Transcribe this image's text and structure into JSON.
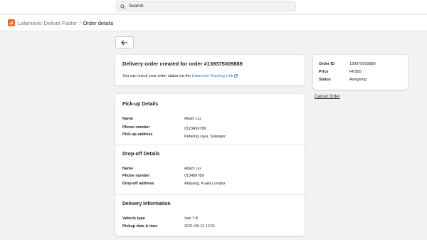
{
  "search": {
    "placeholder": "Search"
  },
  "breadcrumb": {
    "app": "Lalamove: Deliver Faster",
    "separator": "/",
    "current": "Order details"
  },
  "colors": {
    "brand": "#f16622",
    "link": "#2c6ecb"
  },
  "banner": {
    "title": "Delivery order created for order #139375009889",
    "text": "You can check your order status via the",
    "link_text": "Lalamove Tracking Link"
  },
  "summary": {
    "order_id_label": "Order ID",
    "order_id": "139375009889",
    "price_label": "Price",
    "price": "HK$55",
    "status_label": "Status",
    "status": "Assigning"
  },
  "cancel_label": "Cancel Order",
  "pickup": {
    "title": "Pick-up Details",
    "name_label": "Name",
    "name": "Adam Liu",
    "phone_label": "Phone number",
    "phone": "0123456789",
    "address_label": "Pick-up address",
    "address": "Petaling Jaya, Selangor"
  },
  "dropoff": {
    "title": "Drop-off Details",
    "name_label": "Name",
    "name": "Adam Liu",
    "phone_label": "Phone number",
    "phone": "013456789",
    "address_label": "Drop-off address",
    "address": "Ampang, Kuala Lumpur"
  },
  "delivery": {
    "title": "Delivery Information",
    "vehicle_label": "Vehicle type",
    "vehicle": "Van 7-ft",
    "datetime_label": "Pickup date & time",
    "datetime": "2021-08-12 12:01"
  }
}
